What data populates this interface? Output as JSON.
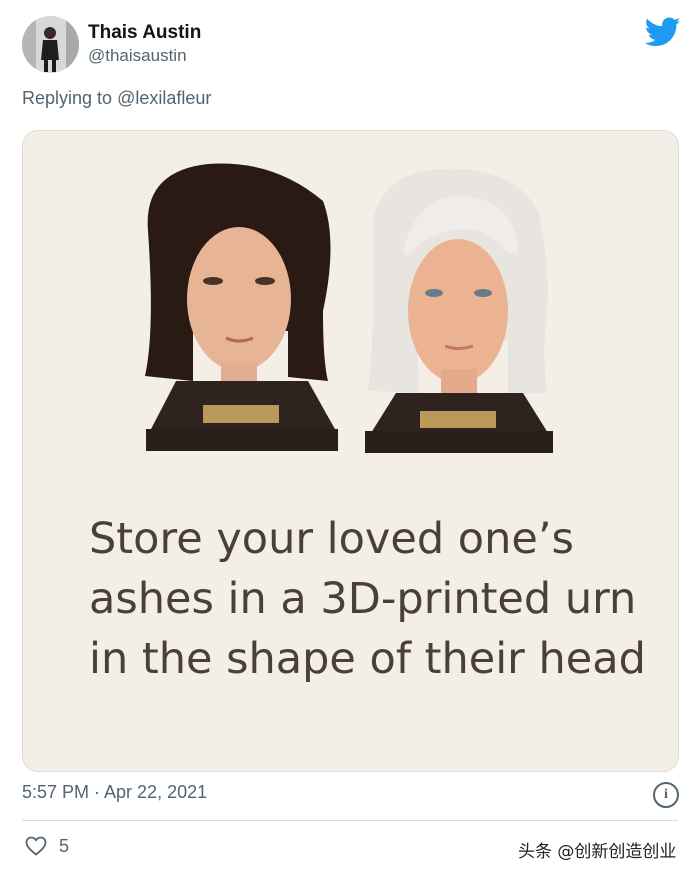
{
  "tweet": {
    "author_name": "Thais Austin",
    "author_handle": "@thaisaustin",
    "replying_prefix": "Replying to ",
    "replying_to": "@lexilafleur",
    "timestamp": "5:57 PM · Apr 22, 2021",
    "like_count": "5"
  },
  "media": {
    "caption": "Store your loved one’s ashes in a 3D-printed urn in the shape of their head"
  },
  "icons": {
    "brand": "twitter-bird-icon",
    "info": "info-icon",
    "like": "heart-icon"
  },
  "colors": {
    "twitter_blue": "#1d9bf0",
    "card_bg": "#f4efe6",
    "muted_text": "#536471"
  },
  "watermark": "头条 @创新创造创业"
}
